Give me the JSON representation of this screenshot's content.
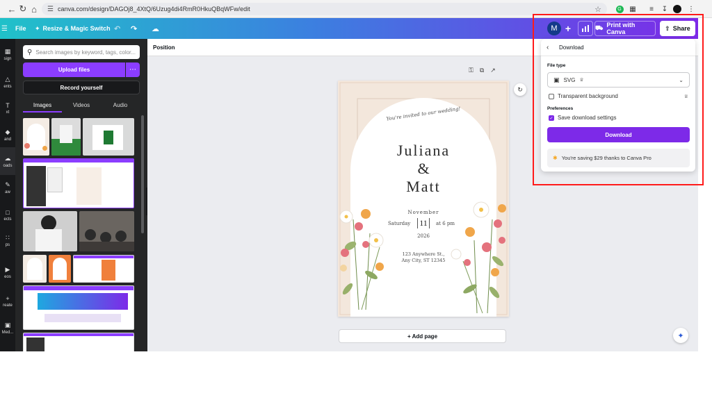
{
  "browser": {
    "url": "canva.com/design/DAGOj8_4XtQ/6Uzug4di4RmR0HkuQBqWFw/edit",
    "back_icon": "arrow-left-icon",
    "reload_icon": "reload-icon",
    "home_icon": "home-icon"
  },
  "topbar": {
    "menu": "File",
    "resize": "Resize & Magic Switch",
    "avatar": "M",
    "print": "Print with Canva",
    "share": "Share"
  },
  "rail": {
    "items": [
      "sign",
      "ents",
      "xt",
      "and",
      "oads",
      "aw",
      "ects",
      "ps",
      "eos",
      "reate",
      "Med..."
    ]
  },
  "panel": {
    "search_placeholder": "Search images by keyword, tags, color...",
    "upload": "Upload files",
    "record": "Record yourself",
    "tabs": [
      "Images",
      "Videos",
      "Audio"
    ]
  },
  "context": {
    "position": "Position"
  },
  "design": {
    "tagline": "You're invited to our wedding!",
    "name1": "Juliana",
    "amp": "&",
    "name2": "Matt",
    "month": "November",
    "day_name": "Saturday",
    "day": "11",
    "time": "at 6 pm",
    "year": "2026",
    "address1": "123 Anywhere St.,",
    "address2": "Any City, ST 12345"
  },
  "canvas": {
    "add_page": "+ Add page"
  },
  "download": {
    "title": "Download",
    "file_type_label": "File type",
    "file_type_value": "SVG",
    "transparent": "Transparent background",
    "preferences_label": "Preferences",
    "save_settings": "Save download settings",
    "button": "Download",
    "promo": "You're saving $29 thanks to Canva Pro"
  },
  "colors": {
    "accent": "#7d2ae8",
    "highlight_box": "#ff1a1a",
    "panel_bg": "#252627"
  }
}
